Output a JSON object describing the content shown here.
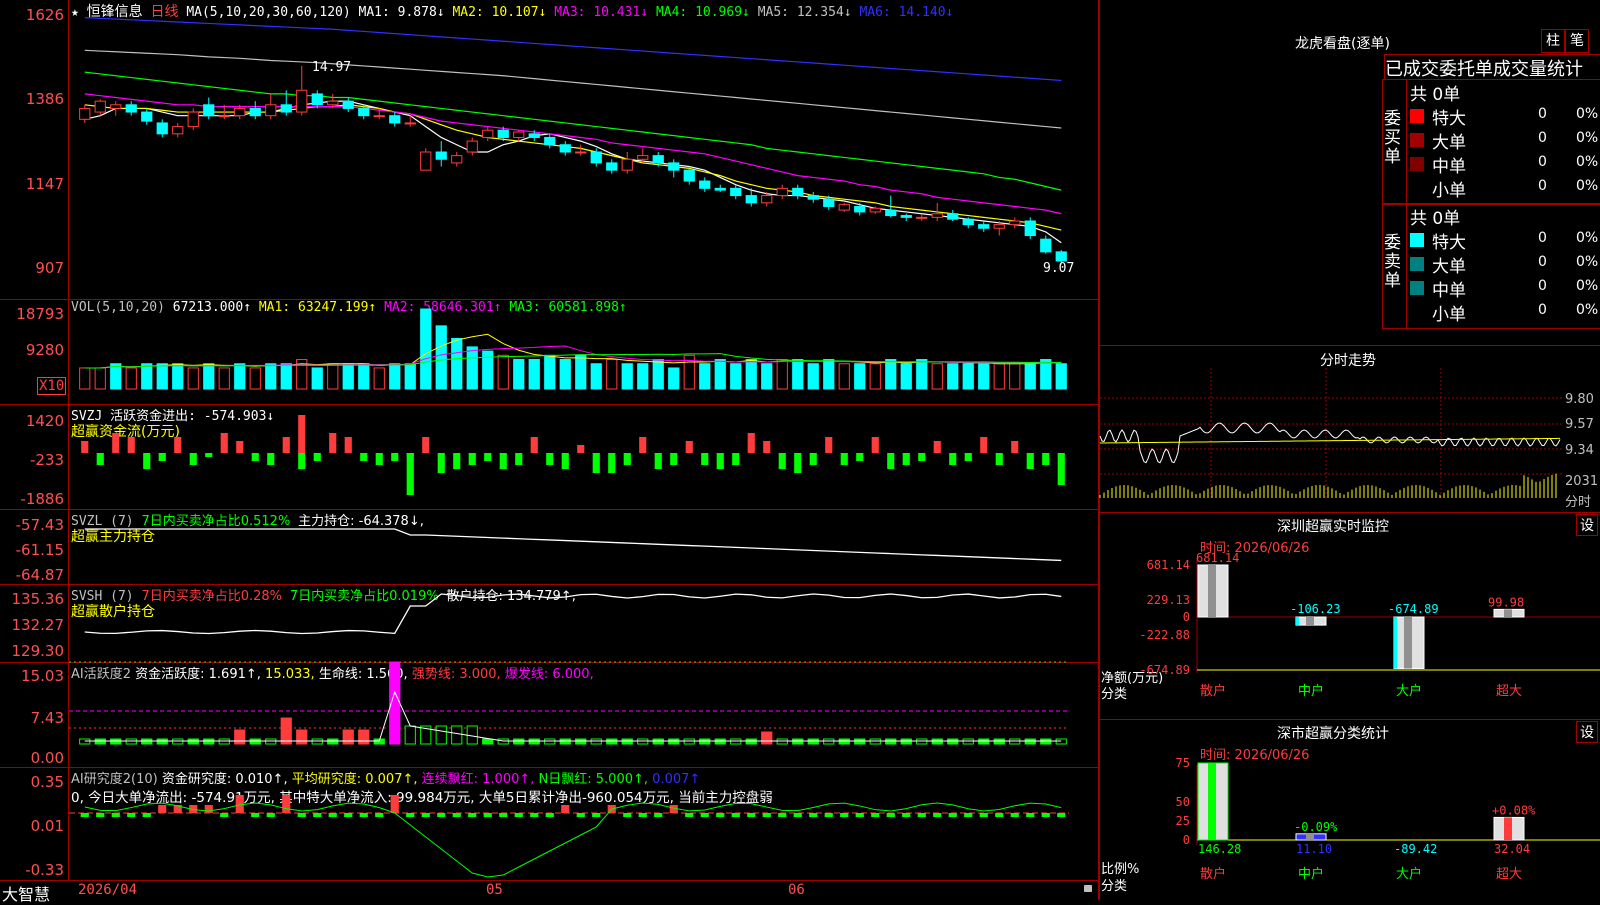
{
  "colors": {
    "up": "#ff3c3c",
    "down": "#00ffff",
    "bg": "#000000",
    "grid": "#a00000",
    "yellow": "#ffff00",
    "magenta": "#ff00ff",
    "green": "#00ff00",
    "white": "#ffffff",
    "blue": "#3030ff"
  },
  "price": {
    "star": "★",
    "stock_name": "恒锋信息",
    "period": "日线",
    "ma_def": "MA(5,10,20,30,60,120)",
    "ma1": "MA1: 9.878↓",
    "ma2": "MA2: 10.107↓",
    "ma3": "MA3: 10.431↓",
    "ma4": "MA4: 10.969↓",
    "ma5": "MA5: 12.354↓",
    "ma6": "MA6: 14.140↓",
    "ticks": [
      "1626",
      "1386",
      "1147",
      "907"
    ],
    "high_label": "14.97",
    "low_label": "9.07",
    "candles": [
      [
        13.5,
        13.8,
        13.4,
        13.9
      ],
      [
        13.7,
        14.0,
        13.6,
        14.05
      ],
      [
        13.8,
        13.9,
        13.6,
        14.0
      ],
      [
        13.9,
        13.7,
        13.6,
        14.0
      ],
      [
        13.7,
        13.45,
        13.35,
        13.8
      ],
      [
        13.4,
        13.1,
        13.0,
        13.5
      ],
      [
        13.1,
        13.3,
        13.0,
        13.4
      ],
      [
        13.3,
        13.7,
        13.2,
        13.8
      ],
      [
        13.9,
        13.6,
        13.5,
        14.1
      ],
      [
        13.6,
        13.6,
        13.5,
        13.9
      ],
      [
        13.6,
        13.8,
        13.5,
        13.9
      ],
      [
        13.8,
        13.6,
        13.5,
        14.0
      ],
      [
        13.6,
        13.9,
        13.5,
        14.2
      ],
      [
        13.9,
        13.7,
        13.6,
        14.3
      ],
      [
        13.7,
        14.3,
        13.6,
        14.97
      ],
      [
        14.2,
        13.9,
        13.8,
        14.3
      ],
      [
        13.9,
        14.0,
        13.8,
        14.2
      ],
      [
        14.0,
        13.8,
        13.7,
        14.1
      ],
      [
        13.8,
        13.6,
        13.5,
        13.9
      ],
      [
        13.6,
        13.6,
        13.5,
        13.8
      ],
      [
        13.6,
        13.4,
        13.3,
        13.7
      ],
      [
        13.4,
        13.4,
        13.3,
        13.6
      ],
      [
        12.1,
        12.6,
        12.1,
        12.7
      ],
      [
        12.6,
        12.4,
        12.2,
        12.9
      ],
      [
        12.3,
        12.5,
        12.2,
        12.6
      ],
      [
        12.6,
        12.9,
        12.5,
        13.0
      ],
      [
        13.0,
        13.2,
        12.9,
        13.3
      ],
      [
        13.2,
        13.0,
        12.9,
        13.3
      ],
      [
        13.0,
        13.15,
        12.9,
        13.2
      ],
      [
        13.1,
        13.0,
        12.9,
        13.2
      ],
      [
        13.0,
        12.8,
        12.7,
        13.1
      ],
      [
        12.8,
        12.6,
        12.5,
        12.9
      ],
      [
        12.6,
        12.6,
        12.5,
        12.8
      ],
      [
        12.6,
        12.3,
        12.2,
        12.7
      ],
      [
        12.3,
        12.1,
        12.0,
        12.4
      ],
      [
        12.1,
        12.4,
        12.0,
        12.6
      ],
      [
        12.4,
        12.5,
        12.3,
        12.7
      ],
      [
        12.5,
        12.3,
        12.2,
        12.6
      ],
      [
        12.3,
        12.1,
        11.9,
        12.4
      ],
      [
        12.1,
        11.8,
        11.7,
        12.2
      ],
      [
        11.8,
        11.6,
        11.5,
        11.9
      ],
      [
        11.6,
        11.55,
        11.5,
        11.7
      ],
      [
        11.6,
        11.4,
        11.3,
        11.7
      ],
      [
        11.4,
        11.2,
        11.1,
        11.6
      ],
      [
        11.2,
        11.4,
        11.1,
        11.5
      ],
      [
        11.4,
        11.6,
        11.3,
        11.7
      ],
      [
        11.6,
        11.4,
        11.3,
        11.7
      ],
      [
        11.4,
        11.3,
        11.2,
        11.5
      ],
      [
        11.3,
        11.1,
        11.0,
        11.4
      ],
      [
        11.0,
        11.15,
        10.95,
        11.2
      ],
      [
        11.1,
        10.95,
        10.85,
        11.2
      ],
      [
        10.95,
        11.05,
        10.9,
        11.1
      ],
      [
        11.0,
        10.85,
        10.8,
        11.4
      ],
      [
        10.85,
        10.8,
        10.7,
        10.9
      ],
      [
        10.8,
        10.8,
        10.7,
        10.9
      ],
      [
        10.8,
        10.9,
        10.7,
        11.2
      ],
      [
        10.9,
        10.75,
        10.7,
        11.0
      ],
      [
        10.75,
        10.6,
        10.5,
        10.8
      ],
      [
        10.6,
        10.5,
        10.4,
        10.7
      ],
      [
        10.5,
        10.6,
        10.3,
        10.7
      ],
      [
        10.6,
        10.7,
        10.5,
        10.8
      ],
      [
        10.7,
        10.3,
        10.2,
        10.8
      ],
      [
        10.2,
        9.85,
        9.8,
        10.3
      ],
      [
        9.85,
        9.6,
        9.5,
        9.9
      ]
    ],
    "ma_series": [
      {
        "name": "MA1",
        "color": "#ffffff",
        "values": [
          13.5,
          13.6,
          13.8,
          13.8,
          13.8,
          13.7,
          13.6,
          13.6,
          13.6,
          13.6,
          13.6,
          13.7,
          13.7,
          13.8,
          13.9,
          13.95,
          14.0,
          14.0,
          13.9,
          13.8,
          13.7,
          13.6,
          13.3,
          13.0,
          12.8,
          12.6,
          12.6,
          12.8,
          12.9,
          13.05,
          13.1,
          13.0,
          12.9,
          12.75,
          12.55,
          12.4,
          12.35,
          12.3,
          12.25,
          12.2,
          12.1,
          11.9,
          11.7,
          11.55,
          11.45,
          11.4,
          11.4,
          11.35,
          11.3,
          11.25,
          11.15,
          11.05,
          11.0,
          10.95,
          10.9,
          10.85,
          10.8,
          10.75,
          10.7,
          10.65,
          10.6,
          10.55,
          10.4,
          10.1
        ]
      },
      {
        "name": "MA2",
        "color": "#ffff00",
        "values": [
          13.9,
          13.85,
          13.8,
          13.8,
          13.8,
          13.75,
          13.7,
          13.7,
          13.7,
          13.7,
          13.7,
          13.7,
          13.7,
          13.75,
          13.8,
          13.85,
          13.85,
          13.9,
          13.85,
          13.8,
          13.7,
          13.65,
          13.5,
          13.35,
          13.2,
          13.1,
          13.0,
          12.95,
          12.9,
          12.85,
          12.8,
          12.75,
          12.7,
          12.6,
          12.5,
          12.4,
          12.3,
          12.25,
          12.2,
          12.15,
          12.05,
          11.95,
          11.8,
          11.7,
          11.6,
          11.55,
          11.5,
          11.4,
          11.35,
          11.3,
          11.25,
          11.2,
          11.1,
          11.05,
          11.0,
          10.95,
          10.9,
          10.85,
          10.8,
          10.75,
          10.7,
          10.65,
          10.55,
          10.45
        ]
      },
      {
        "name": "MA3",
        "color": "#ff00ff",
        "values": [
          14.2,
          14.15,
          14.1,
          14.05,
          14.0,
          13.95,
          13.9,
          13.9,
          13.85,
          13.85,
          13.85,
          13.85,
          13.85,
          13.85,
          13.85,
          13.85,
          13.85,
          13.85,
          13.8,
          13.75,
          13.7,
          13.65,
          13.55,
          13.45,
          13.4,
          13.35,
          13.3,
          13.25,
          13.2,
          13.15,
          13.1,
          13.05,
          13.0,
          12.95,
          12.85,
          12.8,
          12.75,
          12.7,
          12.65,
          12.6,
          12.55,
          12.45,
          12.35,
          12.25,
          12.15,
          12.05,
          11.95,
          11.9,
          11.85,
          11.8,
          11.7,
          11.65,
          11.55,
          11.5,
          11.45,
          11.35,
          11.3,
          11.25,
          11.2,
          11.15,
          11.1,
          11.05,
          11.0,
          10.9
        ]
      },
      {
        "name": "MA4",
        "color": "#00ff00",
        "values": [
          14.8,
          14.75,
          14.7,
          14.65,
          14.6,
          14.55,
          14.5,
          14.45,
          14.4,
          14.35,
          14.3,
          14.25,
          14.2,
          14.2,
          14.15,
          14.15,
          14.1,
          14.1,
          14.05,
          14.0,
          13.95,
          13.9,
          13.85,
          13.8,
          13.75,
          13.7,
          13.65,
          13.6,
          13.55,
          13.5,
          13.45,
          13.4,
          13.35,
          13.3,
          13.25,
          13.2,
          13.15,
          13.1,
          13.05,
          13.0,
          12.95,
          12.9,
          12.85,
          12.8,
          12.7,
          12.65,
          12.6,
          12.55,
          12.5,
          12.45,
          12.4,
          12.35,
          12.3,
          12.25,
          12.2,
          12.15,
          12.1,
          12.05,
          12.0,
          11.9,
          11.85,
          11.75,
          11.65,
          11.55
        ]
      },
      {
        "name": "MA5",
        "color": "#c0c0c0",
        "values": [
          15.4,
          15.38,
          15.36,
          15.34,
          15.32,
          15.3,
          15.28,
          15.25,
          15.22,
          15.2,
          15.18,
          15.15,
          15.12,
          15.1,
          15.08,
          15.06,
          15.03,
          15.0,
          14.97,
          14.94,
          14.91,
          14.88,
          14.85,
          14.82,
          14.79,
          14.76,
          14.73,
          14.7,
          14.66,
          14.62,
          14.58,
          14.54,
          14.5,
          14.46,
          14.42,
          14.38,
          14.34,
          14.3,
          14.26,
          14.22,
          14.18,
          14.14,
          14.1,
          14.06,
          14.02,
          13.98,
          13.94,
          13.9,
          13.86,
          13.82,
          13.78,
          13.74,
          13.7,
          13.66,
          13.62,
          13.58,
          13.54,
          13.5,
          13.46,
          13.42,
          13.38,
          13.34,
          13.3,
          13.26
        ]
      },
      {
        "name": "MA6",
        "color": "#3030ff",
        "values": [
          16.3,
          16.28,
          16.26,
          16.24,
          16.22,
          16.2,
          16.18,
          16.16,
          16.14,
          16.12,
          16.1,
          16.08,
          16.06,
          16.04,
          16.02,
          16.0,
          15.98,
          15.95,
          15.92,
          15.89,
          15.86,
          15.83,
          15.8,
          15.77,
          15.74,
          15.71,
          15.68,
          15.65,
          15.62,
          15.59,
          15.56,
          15.53,
          15.5,
          15.47,
          15.44,
          15.41,
          15.38,
          15.35,
          15.32,
          15.29,
          15.26,
          15.23,
          15.2,
          15.17,
          15.14,
          15.11,
          15.08,
          15.05,
          15.02,
          14.99,
          14.96,
          14.93,
          14.9,
          14.87,
          14.84,
          14.81,
          14.78,
          14.75,
          14.72,
          14.69,
          14.66,
          14.63,
          14.6,
          14.57
        ]
      }
    ]
  },
  "vol": {
    "header": "VOL(5,10,20)",
    "value": "67213.000↑",
    "ma1": "MA1: 63247.199↑",
    "ma2": "MA2: 58646.301↑",
    "ma3": "MA3: 60581.898↑",
    "ticks": [
      "18793",
      "9280"
    ],
    "unit": "X10",
    "bars": [
      5,
      5,
      6,
      5,
      6,
      6,
      6,
      5,
      6,
      5,
      6,
      5,
      6,
      6,
      7,
      5,
      6,
      6,
      6,
      5,
      6,
      6,
      19,
      15,
      12,
      10,
      9,
      8,
      7,
      7,
      8,
      7,
      8,
      6,
      7,
      6,
      6,
      7,
      5,
      8,
      6,
      7,
      6,
      7,
      6,
      7,
      7,
      6,
      7,
      6,
      6,
      6,
      7,
      6,
      7,
      6,
      6,
      6,
      6,
      6,
      6,
      6,
      7,
      6
    ],
    "up_flags": [
      1,
      1,
      0,
      1,
      0,
      0,
      0,
      1,
      0,
      1,
      0,
      1,
      0,
      0,
      1,
      0,
      1,
      0,
      0,
      1,
      0,
      0,
      0,
      0,
      0,
      0,
      0,
      1,
      0,
      0,
      0,
      0,
      0,
      0,
      1,
      0,
      0,
      0,
      0,
      1,
      0,
      0,
      0,
      0,
      0,
      1,
      0,
      0,
      0,
      1,
      0,
      1,
      0,
      0,
      0,
      1,
      0,
      0,
      0,
      1,
      1,
      0,
      0,
      0
    ]
  },
  "svzj": {
    "header": "SVZJ  活跃资金进出: -574.903↓",
    "sub": "超赢资金流(万元)",
    "ticks": [
      "1420",
      "-233",
      "-1886"
    ],
    "values": [
      0.3,
      -0.3,
      0.5,
      0.4,
      -0.4,
      -0.2,
      0.4,
      -0.3,
      -0.1,
      0.5,
      0.3,
      -0.2,
      -0.3,
      0.4,
      -0.4,
      -0.2,
      0.5,
      0.4,
      -0.2,
      -0.3,
      -0.2,
      -0.1,
      0.4,
      -0.5,
      -0.4,
      -0.3,
      -0.2,
      -0.4,
      -0.3,
      0.4,
      -0.3,
      -0.4,
      0.2,
      -0.5,
      -0.5,
      -0.3,
      0.4,
      -0.4,
      -0.3,
      0.3,
      -0.3,
      -0.4,
      -0.3,
      0.5,
      0.3,
      -0.4,
      -0.5,
      -0.3,
      0.4,
      -0.3,
      -0.2,
      0.4,
      -0.4,
      -0.3,
      -0.2,
      0.3,
      -0.3,
      -0.2,
      0.4,
      -0.3,
      0.3,
      -0.4,
      -0.3,
      -0.8
    ]
  },
  "svzl": {
    "header_a": "SVZL (7)",
    "header_b": "7日内买卖净占比0.512%",
    "header_c": "主力持仓: -64.378↓,",
    "sub": "超赢主力持仓",
    "ticks": [
      "-57.43",
      "-61.15",
      "-64.87"
    ]
  },
  "svsh": {
    "header_a": "SVSH (7)",
    "header_b": "7日内买卖净占比0.28%",
    "header_c": "7日内买卖净占比0.019%",
    "header_d": "散户持仓: 134.779↑,",
    "sub": "超赢散户持仓",
    "ticks": [
      "135.36",
      "132.27",
      "129.30"
    ]
  },
  "ai1": {
    "header_a": "AI活跃度2",
    "header_b": "资金活跃度: 1.691↑,",
    "header_c": "15.033,",
    "header_d": "生命线: 1.560,",
    "header_e": "强势线: 3.000,",
    "header_f": "爆发线: 6.000,",
    "ticks": [
      "15.03",
      "7.43",
      "0.00"
    ]
  },
  "ai2": {
    "header_a": "AI研究度2(10)",
    "header_b": "资金研究度: 0.010↑,",
    "header_c": "平均研究度: 0.007↑,",
    "header_d": "连续飘红: 1.000↑,",
    "header_e": "N日飘红: 5.000↑,",
    "header_f": "0.007↑",
    "sub": "0, 今日大单净流出: -574.91万元, 其中特大单净流入: 99.984万元, 大单5日累计净出-960.054万元, 当前主力控盘弱",
    "ticks": [
      "0.35",
      "0.01",
      "-0.33"
    ]
  },
  "bottom": {
    "brand": "大智慧",
    "date1": "2026/04",
    "date2": "05",
    "date3": "06"
  },
  "dragon": {
    "title": "龙虎看盘(逐单)",
    "btn1": "柱",
    "btn2": "笔",
    "tab_header": "已成交委托单成交量统计",
    "buy_label": "委买单",
    "sell_label": "委卖单",
    "buy_total": "共 0单",
    "sell_total": "共 0单",
    "buy_rows": [
      {
        "label": "特大",
        "count": "0",
        "pct": "0%",
        "color": "#ff0000"
      },
      {
        "label": "大单",
        "count": "0",
        "pct": "0%",
        "color": "#a00000"
      },
      {
        "label": "中单",
        "count": "0",
        "pct": "0%",
        "color": "#800000"
      },
      {
        "label": "小单",
        "count": "0",
        "pct": "0%",
        "color": "#000000"
      }
    ],
    "sell_rows": [
      {
        "label": "特大",
        "count": "0",
        "pct": "0%",
        "color": "#00ffff"
      },
      {
        "label": "大单",
        "count": "0",
        "pct": "0%",
        "color": "#008080"
      },
      {
        "label": "中单",
        "count": "0",
        "pct": "0%",
        "color": "#008080"
      },
      {
        "label": "小单",
        "count": "0",
        "pct": "0%",
        "color": "#000000"
      }
    ]
  },
  "minute": {
    "title": "分时走势",
    "ticks": [
      "9.80",
      "9.57",
      "9.34"
    ],
    "vol_tick": "2031",
    "vol_unit": "分时"
  },
  "sz_monitor": {
    "title": "深圳超赢实时监控",
    "btn": "设",
    "time": "时间: 2026/06/26",
    "ticks": [
      "681.14",
      "229.13",
      "0",
      "-222.88",
      "-674.89"
    ],
    "axis_label_a": "净额(万元)",
    "axis_label_b": "分类",
    "bars": [
      {
        "cat": "散户",
        "value": 681.14,
        "label": "681.14"
      },
      {
        "cat": "中户",
        "value": -106.23,
        "label": "-106.23"
      },
      {
        "cat": "大户",
        "value": -674.89,
        "label": "-674.89"
      },
      {
        "cat": "超大",
        "value": 99.98,
        "label": "99.98"
      }
    ]
  },
  "sz_stats": {
    "title": "深市超赢分类统计",
    "btn": "设",
    "time": "时间: 2026/06/26",
    "ticks": [
      "75",
      "50",
      "25",
      "0"
    ],
    "axis_label_a": "比例%",
    "axis_label_b": "分类",
    "bars": [
      {
        "cat": "散户",
        "value": 146.28,
        "label": "146.28",
        "pct": ""
      },
      {
        "cat": "中户",
        "value": 11.1,
        "label": "11.10",
        "pct": "-0.09%"
      },
      {
        "cat": "大户",
        "value": -89.42,
        "label": "-89.42",
        "pct": ""
      },
      {
        "cat": "超大",
        "value": 32.04,
        "label": "32.04",
        "pct": "+0.08%"
      }
    ]
  }
}
